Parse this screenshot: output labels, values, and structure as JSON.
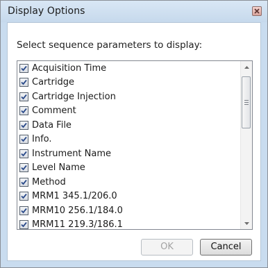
{
  "window": {
    "title": "Display Options"
  },
  "prompt": "Select sequence parameters to display:",
  "parameters": [
    {
      "label": "Acquisition Time",
      "checked": true
    },
    {
      "label": "Cartridge",
      "checked": true
    },
    {
      "label": "Cartridge Injection",
      "checked": true
    },
    {
      "label": "Comment",
      "checked": true
    },
    {
      "label": "Data File",
      "checked": true
    },
    {
      "label": "Info.",
      "checked": true
    },
    {
      "label": "Instrument Name",
      "checked": true
    },
    {
      "label": "Level Name",
      "checked": true
    },
    {
      "label": "Method",
      "checked": true
    },
    {
      "label": "MRM1 345.1/206.0",
      "checked": true
    },
    {
      "label": "MRM10 256.1/184.0",
      "checked": true
    },
    {
      "label": "MRM11 219.3/186.1",
      "checked": true
    }
  ],
  "buttons": {
    "ok_label": "OK",
    "ok_enabled": false,
    "cancel_label": "Cancel"
  },
  "colors": {
    "frame": "#c9dcef",
    "checkmark": "#2a4a8a",
    "close_button": "#d9a49d"
  },
  "icons": {
    "close": "close-icon",
    "checkbox": "checkmark-icon",
    "scroll_up": "chevron-up-icon",
    "scroll_down": "chevron-down-icon",
    "scroll_thumb": "scroll-grip-icon"
  }
}
